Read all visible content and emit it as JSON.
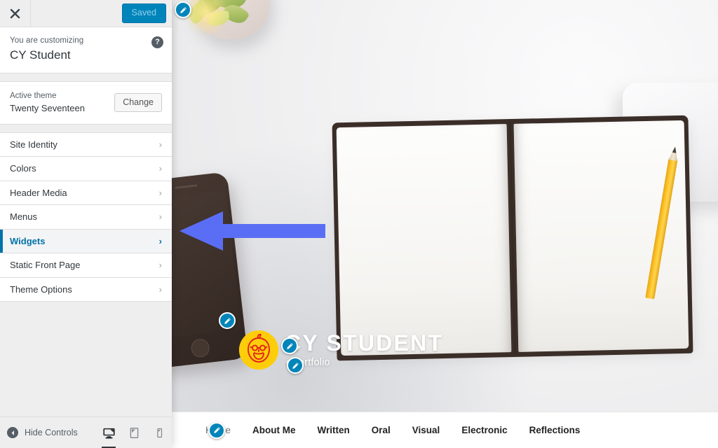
{
  "customizer": {
    "topbar": {
      "close_label": "Close",
      "close_icon": "close-icon",
      "save_button": "Saved"
    },
    "info": {
      "eyebrow": "You are customizing",
      "site_name": "CY Student",
      "help_icon": "?"
    },
    "theme": {
      "label": "Active theme",
      "name": "Twenty Seventeen",
      "change_button": "Change"
    },
    "panels": [
      {
        "label": "Site Identity",
        "active": false,
        "arrow": "›"
      },
      {
        "label": "Colors",
        "active": false,
        "arrow": "›"
      },
      {
        "label": "Header Media",
        "active": false,
        "arrow": "›"
      },
      {
        "label": "Menus",
        "active": false,
        "arrow": "›"
      },
      {
        "label": "Widgets",
        "active": true,
        "arrow": "›"
      },
      {
        "label": "Static Front Page",
        "active": false,
        "arrow": "›"
      },
      {
        "label": "Theme Options",
        "active": false,
        "arrow": "›"
      }
    ],
    "bottom": {
      "hide_controls_label": "Hide Controls",
      "hide_controls_icon": "collapse-left-icon",
      "devices": [
        {
          "name": "desktop",
          "icon": "desktop-icon",
          "active": true
        },
        {
          "name": "tablet",
          "icon": "tablet-icon",
          "active": false
        },
        {
          "name": "mobile",
          "icon": "mobile-icon",
          "active": false
        }
      ]
    },
    "accent_color": "#0073aa",
    "save_button_color": "#0085ba"
  },
  "preview": {
    "branding": {
      "site_title": "CY STUDENT",
      "tagline": "ePortfolio",
      "logo_icon": "site-logo-avatar",
      "logo_background": "#fdcd0a",
      "logo_line_color": "#e2231a"
    },
    "edit_shortcuts": [
      {
        "name": "header-image-edit",
        "icon": "pencil-icon"
      },
      {
        "name": "widget-area-edit",
        "icon": "pencil-icon"
      },
      {
        "name": "site-title-edit",
        "icon": "pencil-icon"
      },
      {
        "name": "tagline-edit",
        "icon": "pencil-icon"
      },
      {
        "name": "nav-menu-edit",
        "icon": "pencil-icon"
      }
    ],
    "nav": [
      {
        "label": "Home",
        "current": true
      },
      {
        "label": "About Me",
        "current": false
      },
      {
        "label": "Written",
        "current": false
      },
      {
        "label": "Oral",
        "current": false
      },
      {
        "label": "Visual",
        "current": false
      },
      {
        "label": "Electronic",
        "current": false
      },
      {
        "label": "Reflections",
        "current": false
      }
    ]
  },
  "annotation": {
    "arrow_direction": "left",
    "arrow_color": "#5a6ef5",
    "points_to": "Widgets"
  }
}
